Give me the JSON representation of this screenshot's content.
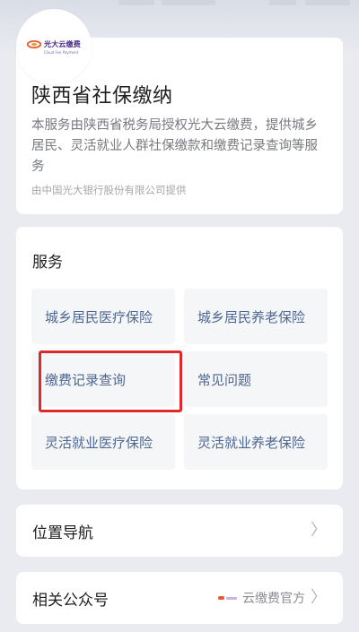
{
  "logo": {
    "name": "光大云缴费",
    "sub": "Cloud Fee Payment"
  },
  "intro": {
    "title": "陕西省社保缴纳",
    "description": "本服务由陕西省税务局授权光大云缴费，提供城乡居民、灵活就业人群社保缴款和缴费记录查询等服务",
    "provider": "由中国光大银行股份有限公司提供"
  },
  "services": {
    "heading": "服务",
    "items": [
      {
        "label": "城乡居民医疗保险"
      },
      {
        "label": "城乡居民养老保险"
      },
      {
        "label": "缴费记录查询"
      },
      {
        "label": "常见问题"
      },
      {
        "label": "灵活就业医疗保险"
      },
      {
        "label": "灵活就业养老保险"
      }
    ]
  },
  "location_nav": {
    "label": "位置导航"
  },
  "public_account": {
    "label": "相关公众号",
    "value": "云缴费官方"
  },
  "colors": {
    "accent_text": "#4d6692",
    "highlight": "#e0272a",
    "brand_orange": "#e85a2c",
    "brand_purple": "#4b2a85"
  },
  "icons": [
    "brand-logo-icon",
    "chevron-right-icon"
  ]
}
